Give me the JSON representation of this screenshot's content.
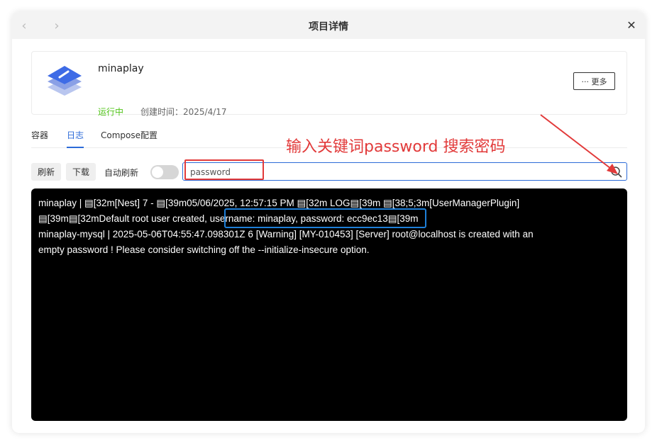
{
  "window": {
    "title": "项目详情",
    "nav_back_icon": "chevron-left-icon",
    "nav_forward_icon": "chevron-right-icon",
    "close_icon": "close-icon"
  },
  "app": {
    "name": "minaplay",
    "status": "运行中",
    "created": "创建时间：2025/4/17",
    "more_button": "··· 更多",
    "status_color": "#52c41a"
  },
  "tabs": [
    {
      "label": "容器"
    },
    {
      "label": "日志"
    },
    {
      "label": "Compose配置"
    }
  ],
  "toolbar": {
    "refresh": "刷新",
    "download": "下载",
    "auto_refresh": "自动刷新",
    "auto_refresh_on": false
  },
  "search": {
    "value": "password",
    "icon": "search-icon"
  },
  "annotation": {
    "text": "输入关键词password 搜索密码",
    "color": "#e23a3a"
  },
  "logs": {
    "line1": "minaplay       | ▤[32m[Nest] 7  - ▤[39m05/06/2025, 12:57:15 PM ▤[32m    LOG▤[39m ▤[38;5;3m[UserManagerPlugin]",
    "line2_pre": "▤[39m▤[32mDefault root user created",
    "line2_highlight": ", username: minaplay, password: ecc9ec13",
    "line2_post": "▤[39m",
    "line3": "minaplay-mysql  | 2025-05-06T04:55:47.098301Z 6 [Warning] [MY-010453] [Server] root@localhost is created with an",
    "line4": "empty password ! Please consider switching off the --initialize-insecure option."
  },
  "colors": {
    "accent": "#2c6bd8",
    "annotation": "#e23a3a",
    "log_highlight": "#1e7fd8"
  }
}
